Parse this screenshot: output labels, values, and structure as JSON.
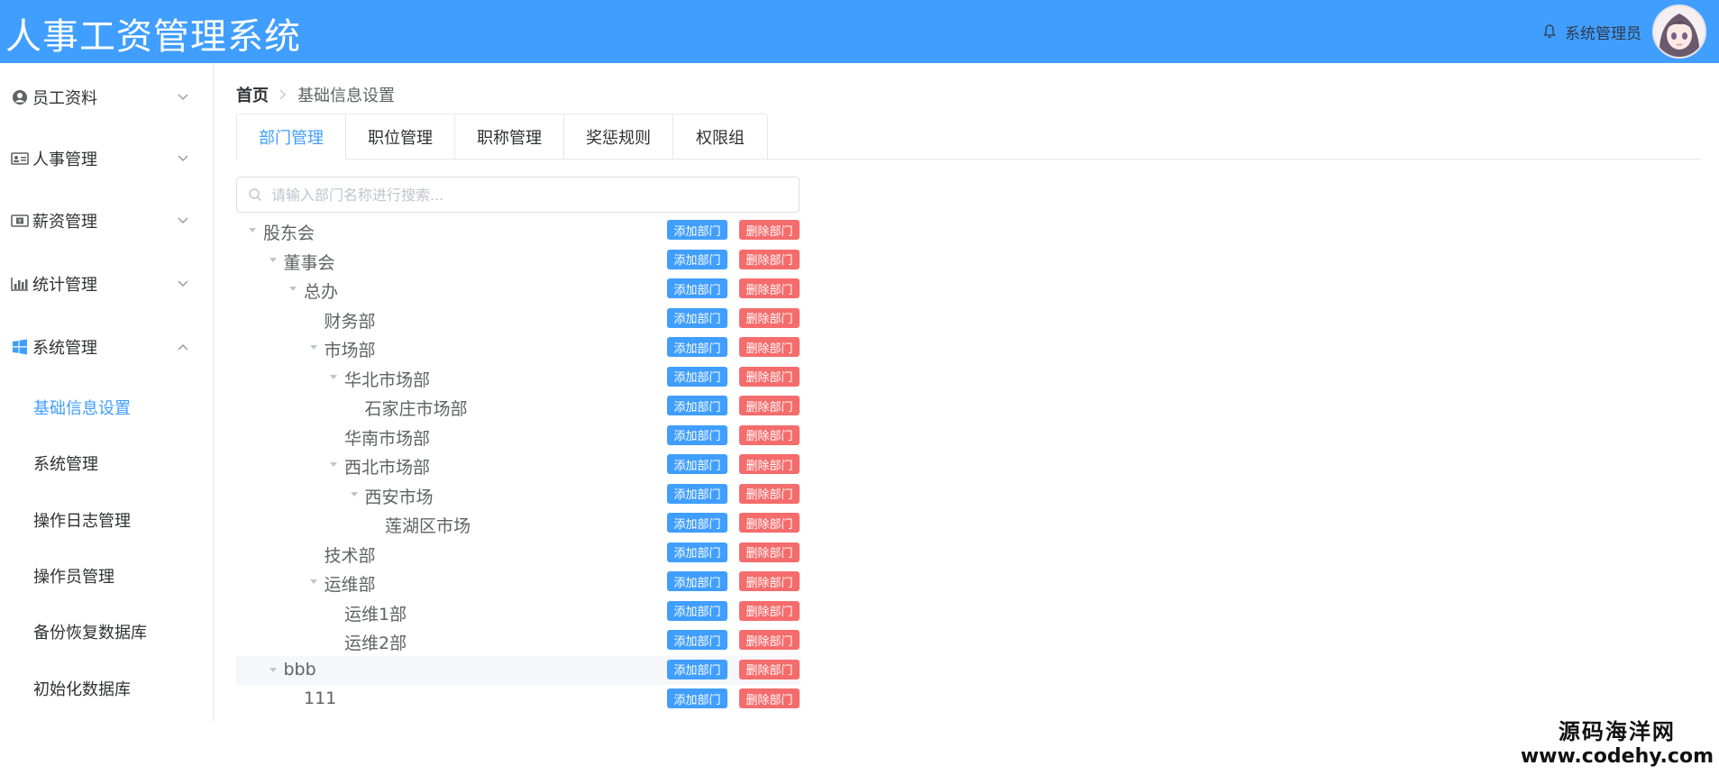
{
  "app": {
    "title": "人事工资管理系统",
    "user_name": "系统管理员"
  },
  "sidebar": {
    "menus": [
      {
        "label": "员工资料",
        "icon": "user-circle-icon",
        "expanded": false
      },
      {
        "label": "人事管理",
        "icon": "id-card-icon",
        "expanded": false
      },
      {
        "label": "薪资管理",
        "icon": "money-icon",
        "expanded": false
      },
      {
        "label": "统计管理",
        "icon": "bar-chart-icon",
        "expanded": false
      },
      {
        "label": "系统管理",
        "icon": "windows-icon",
        "expanded": true
      }
    ],
    "sub_items": [
      {
        "label": "基础信息设置",
        "active": true
      },
      {
        "label": "系统管理",
        "active": false
      },
      {
        "label": "操作日志管理",
        "active": false
      },
      {
        "label": "操作员管理",
        "active": false
      },
      {
        "label": "备份恢复数据库",
        "active": false
      },
      {
        "label": "初始化数据库",
        "active": false
      }
    ]
  },
  "breadcrumb": {
    "home": "首页",
    "current": "基础信息设置"
  },
  "tabs": [
    {
      "label": "部门管理",
      "active": true
    },
    {
      "label": "职位管理",
      "active": false
    },
    {
      "label": "职称管理",
      "active": false
    },
    {
      "label": "奖惩规则",
      "active": false
    },
    {
      "label": "权限组",
      "active": false
    }
  ],
  "search": {
    "placeholder": "请输入部门名称进行搜索...",
    "value": ""
  },
  "tree": {
    "add_label": "添加部门",
    "delete_label": "删除部门",
    "nodes": [
      {
        "label": "股东会",
        "level": 0,
        "has_children": true
      },
      {
        "label": "董事会",
        "level": 1,
        "has_children": true
      },
      {
        "label": "总办",
        "level": 2,
        "has_children": true
      },
      {
        "label": "财务部",
        "level": 3,
        "has_children": false
      },
      {
        "label": "市场部",
        "level": 3,
        "has_children": true
      },
      {
        "label": "华北市场部",
        "level": 4,
        "has_children": true
      },
      {
        "label": "石家庄市场部",
        "level": 5,
        "has_children": false
      },
      {
        "label": "华南市场部",
        "level": 4,
        "has_children": false
      },
      {
        "label": "西北市场部",
        "level": 4,
        "has_children": true
      },
      {
        "label": "西安市场",
        "level": 5,
        "has_children": true
      },
      {
        "label": "莲湖区市场",
        "level": 6,
        "has_children": false
      },
      {
        "label": "技术部",
        "level": 3,
        "has_children": false
      },
      {
        "label": "运维部",
        "level": 3,
        "has_children": true
      },
      {
        "label": "运维1部",
        "level": 4,
        "has_children": false
      },
      {
        "label": "运维2部",
        "level": 4,
        "has_children": false
      },
      {
        "label": "bbb",
        "level": 1,
        "has_children": true
      },
      {
        "label": "111",
        "level": 2,
        "has_children": false
      }
    ]
  },
  "watermark": {
    "text": "源码海洋网",
    "url": "www.codehy.com"
  },
  "colors": {
    "primary": "#409eff",
    "danger": "#f56c6c",
    "header": "#409eff"
  }
}
